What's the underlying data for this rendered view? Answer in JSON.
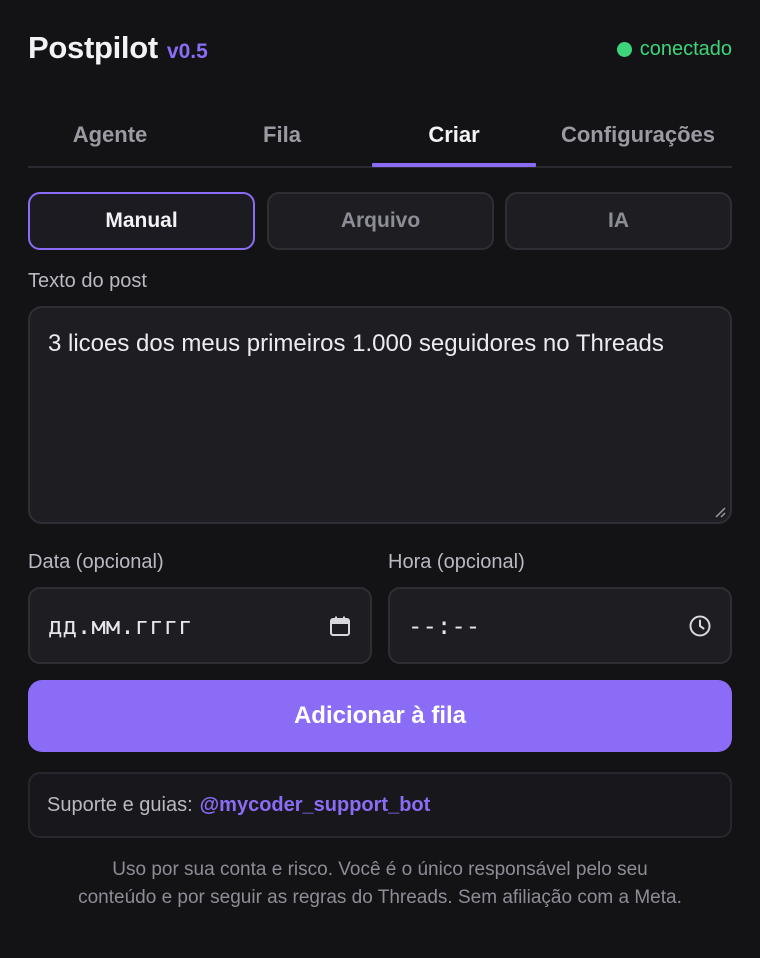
{
  "header": {
    "app_name": "Postpilot",
    "version": "v0.5",
    "status": "conectado",
    "status_color": "#3ed47a",
    "accent_color": "#8b6cf6"
  },
  "tabs": [
    {
      "label": "Agente",
      "active": false
    },
    {
      "label": "Fila",
      "active": false
    },
    {
      "label": "Criar",
      "active": true
    },
    {
      "label": "Configurações",
      "active": false
    }
  ],
  "modes": [
    {
      "label": "Manual",
      "active": true
    },
    {
      "label": "Arquivo",
      "active": false
    },
    {
      "label": "IA",
      "active": false
    }
  ],
  "post": {
    "label": "Texto do post",
    "value": "3 licoes dos meus primeiros 1.000 seguidores no Threads"
  },
  "date": {
    "label": "Data (opcional)",
    "placeholder": "дд.мм.гггг",
    "icon": "calendar-icon"
  },
  "time": {
    "label": "Hora (opcional)",
    "placeholder": "--:--",
    "icon": "clock-icon"
  },
  "submit_label": "Adicionar à fila",
  "support": {
    "label": "Suporte e guias:",
    "link": "@mycoder_support_bot"
  },
  "disclaimer": {
    "line1": "Uso por sua conta e risco. Você é o único responsável pelo seu",
    "line2": "conteúdo e por seguir as regras do Threads. Sem afiliação com a Meta."
  }
}
